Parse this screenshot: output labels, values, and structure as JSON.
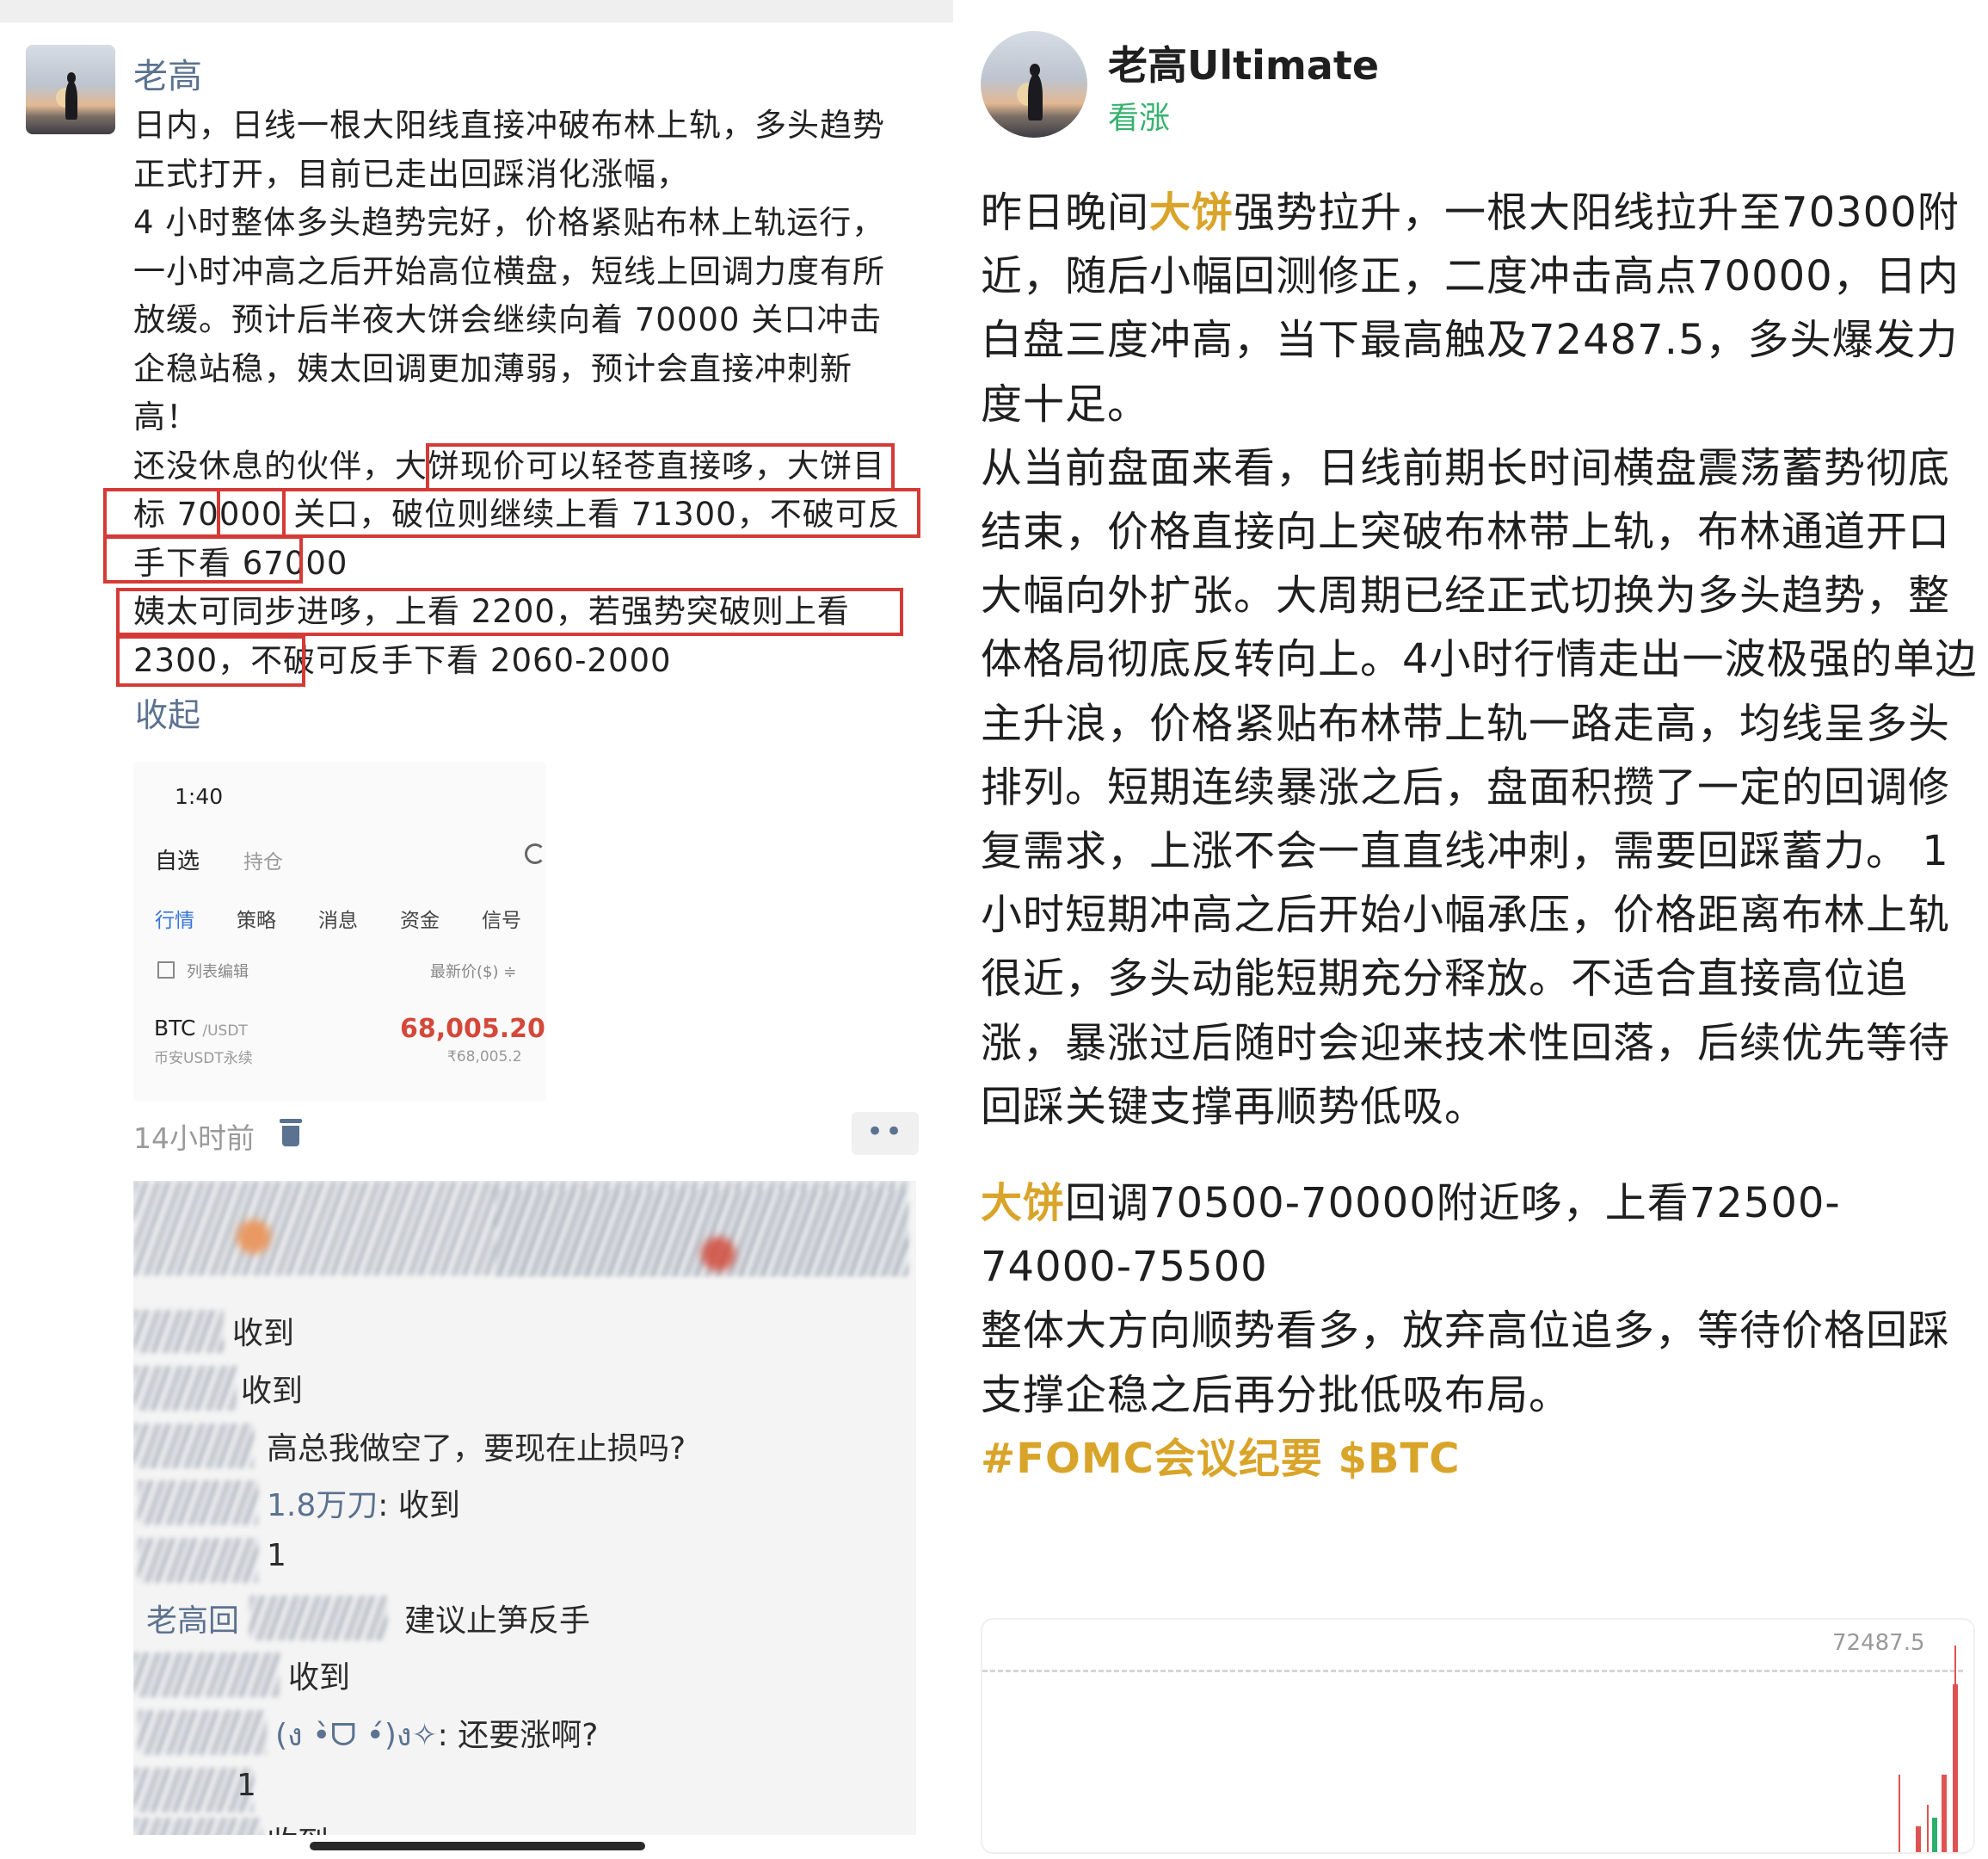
{
  "left": {
    "author": "老高",
    "post_paragraphs": [
      "日内，日线一根大阳线直接冲破布林上轨，多头趋势正式打开，目前已走出回踩消化涨幅，",
      "4 小时整体多头趋势完好，价格紧贴布林上轨运行，一小时冲高之后开始高位横盘，短线上回调力度有所放缓。预计后半夜大饼会继续向着 70000 关口冲击企稳站稳，姨太回调更加薄弱，预计会直接冲刺新高！",
      "还没休息的伙伴，大饼现价可以轻苍直接哆，大饼目标 70000 关口，破位则继续上看 71300，不破可反手下看 67000",
      "姨太可同步进哆，上看 2200，若强势突破则上看 2300，不破可反手下看 2060-2000"
    ],
    "collapse_label": "收起",
    "embed": {
      "time": "1:40",
      "tab_selected": "自选",
      "tab_other": "持仓",
      "nav": [
        "行情",
        "策略",
        "消息",
        "资金",
        "信号"
      ],
      "list_edit": "列表编辑",
      "price_header": "最新价($) ≑",
      "symbol": "BTC",
      "quote": "/USDT",
      "market": "币安USDT永续",
      "price": "68,005.20",
      "price_cny": "₹68,005.2"
    },
    "time_ago": "14小时前",
    "more_label": "••",
    "comments": [
      {
        "who": "",
        "text": "收到"
      },
      {
        "who": "",
        "text": "收到"
      },
      {
        "who": "",
        "text": "高总我做空了，要现在止损吗?"
      },
      {
        "who": "1.8万刀",
        "text": ": 收到"
      },
      {
        "who": "",
        "text": "1"
      },
      {
        "who": "老高回",
        "text": "建议止笋反手"
      },
      {
        "who": "",
        "text": "收到"
      },
      {
        "who": "(ง •̀ᗜ •́)ง✧",
        "text": ": 还要涨啊?"
      },
      {
        "who": "",
        "text": "1"
      },
      {
        "who": "",
        "text": "收到"
      }
    ]
  },
  "right": {
    "author": "老高Ultimate",
    "tag": "看涨",
    "p1_prefix": "昨日晚间",
    "p1_highlight": "大饼",
    "p1_rest": "强势拉升，一根大阳线拉升至70300附近，随后小幅回测修正，二度冲击高点70000，日内白盘三度冲高，当下最高触及72487.5，多头爆发力度十足。",
    "p2": "从当前盘面来看，日线前期长时间横盘震荡蓄势彻底结束，价格直接向上突破布林带上轨，布林通道开口大幅向外扩张。大周期已经正式切换为多头趋势，整体格局彻底反转向上。4小时行情走出一波极强的单边主升浪，价格紧贴布林带上轨一路走高，均线呈多头排列。短期连续暴涨之后，盘面积攒了一定的回调修复需求，上涨不会一直直线冲刺，需要回踩蓄力。 1小时短期冲高之后开始小幅承压，价格距离布林上轨很近，多头动能短期充分释放。不适合直接高位追涨，暴涨过后随时会迎来技术性回落，后续优先等待回踩关键支撑再顺势低吸。",
    "p3_highlight": "大饼",
    "p3_rest": "回调70500-70000附近哆，上看72500-74000-75500",
    "p4": "整体大方向顺势看多，放弃高位追多，等待价格回踩支撑企稳之后再分批低吸布局。",
    "hashtags": "#FOMC会议纪要 $BTC",
    "chart_peak_label": "72487.5"
  },
  "colors": {
    "link_blue": "#5b7290",
    "highlight_gold": "#d9a42a",
    "bullish_green": "#35b26e",
    "box_red": "#d43a36",
    "price_red": "#d4483a"
  }
}
